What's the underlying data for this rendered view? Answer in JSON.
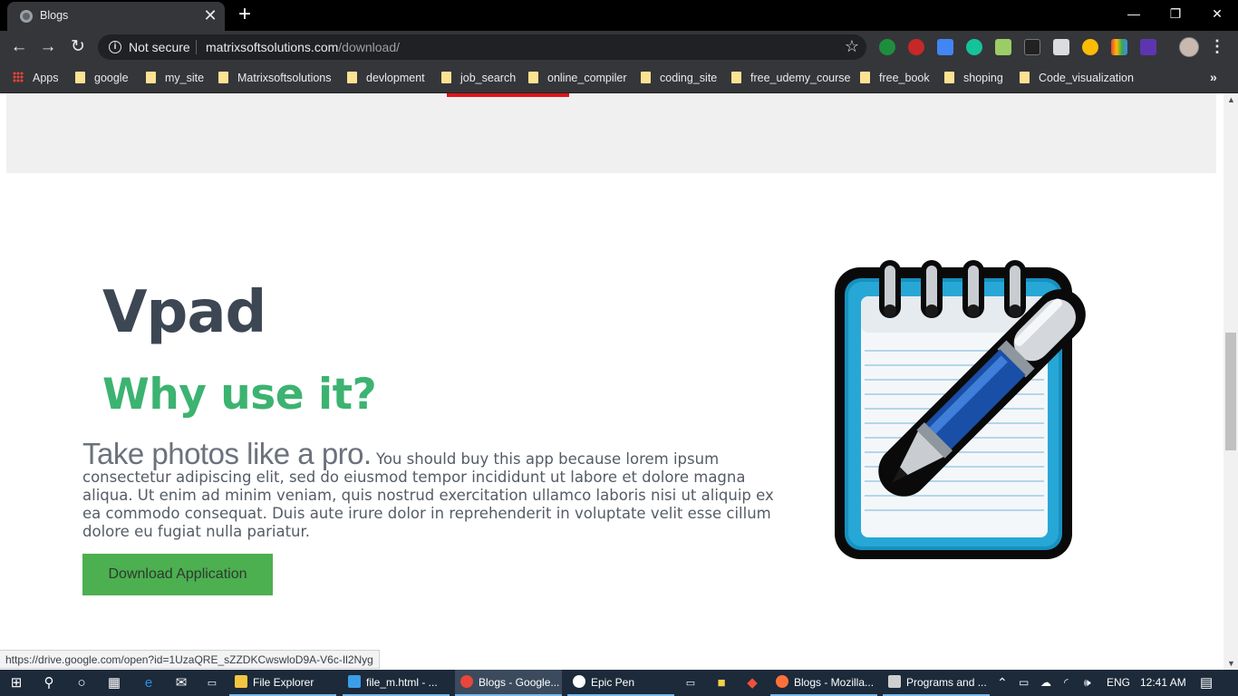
{
  "browser": {
    "tab_title": "Blogs",
    "tab_close": "✕",
    "new_tab": "+",
    "window": {
      "minimize": "—",
      "restore": "❐",
      "close": "✕"
    },
    "security_label": "Not secure",
    "url_host": "matrixsoftsolutions.com",
    "url_path": "/download/",
    "status_url": "https://drive.google.com/open?id=1UzaQRE_sZZDKCwswloD9A-V6c-Il2Nyg"
  },
  "bookmarks": [
    "Apps",
    "google",
    "my_site",
    "Matrixsoftsolutions",
    "devlopment",
    "job_search",
    "online_compiler",
    "coding_site",
    "free_udemy_course",
    "free_book",
    "shoping",
    "Code_visualization"
  ],
  "bookmarks_more": "»",
  "main": {
    "title": "Vpad",
    "subtitle": "Why use it?",
    "lead": "Take photos like a pro.",
    "body": "You should buy this app because lorem ipsum consectetur adipiscing elit, sed do eiusmod tempor incididunt ut labore et dolore magna aliqua. Ut enim ad minim veniam, quis nostrud exercitation ullamco laboris nisi ut aliquip ex ea commodo consequat. Duis aute irure dolor in reprehenderit in voluptate velit esse cillum dolore eu fugiat nulla pariatur.",
    "download_label": "Download Application"
  },
  "taskbar": {
    "apps": [
      {
        "label": "File Explorer",
        "icon": "folder-icon",
        "color": "#f4c542"
      },
      {
        "label": "file_m.html - ...",
        "icon": "vscode-icon",
        "color": "#3b9ee8"
      },
      {
        "label": "Blogs - Google...",
        "icon": "chrome-icon",
        "color": "#e8453c"
      },
      {
        "label": "Epic Pen",
        "icon": "pen-icon",
        "color": "#ffffff"
      },
      {
        "label": "Blogs - Mozilla...",
        "icon": "firefox-icon",
        "color": "#ff7139"
      },
      {
        "label": "Programs and ...",
        "icon": "programs-icon",
        "color": "#cfcfcf"
      }
    ],
    "language": "ENG",
    "time": "12:41 AM"
  },
  "colors": {
    "title": "#3d4653",
    "subtitle": "#3cb371",
    "button": "#4caf50",
    "accent_red": "#e0151b"
  }
}
